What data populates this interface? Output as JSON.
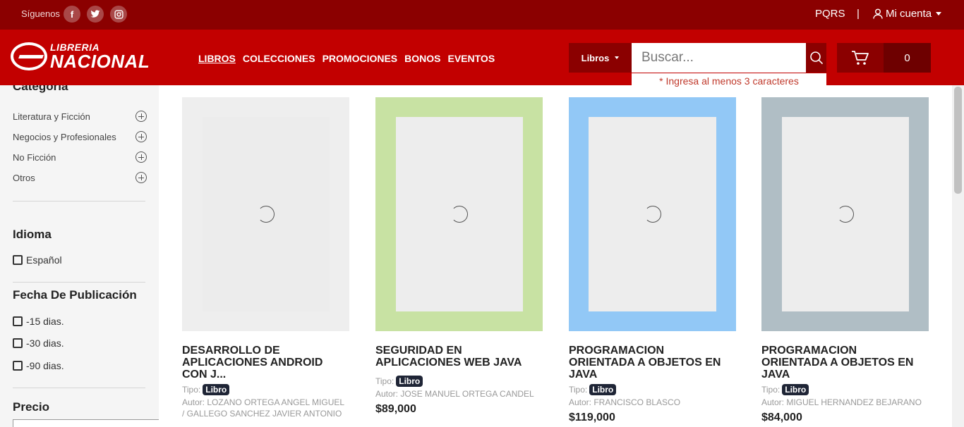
{
  "topbar": {
    "follow_label": "Síguenos",
    "social": [
      {
        "name": "facebook",
        "glyph": "f"
      },
      {
        "name": "twitter",
        "glyph": "t"
      },
      {
        "name": "instagram",
        "glyph": "◎"
      }
    ],
    "pqrs": "PQRS",
    "separator": "|",
    "account_label": "Mi cuenta"
  },
  "header": {
    "logo_line1": "LIBRERIA",
    "logo_line2": "NACIONAL",
    "nav": [
      "LIBROS",
      "COLECCIONES",
      "PROMOCIONES",
      "BONOS",
      "EVENTOS"
    ],
    "search_category": "Libros",
    "search_placeholder": "Buscar...",
    "search_hint": "* Ingresa al menos 3 caracteres",
    "cart_count": "0"
  },
  "sidebar": {
    "category_title": "Categoría",
    "categories": [
      "Literatura y Ficción",
      "Negocios y Profesionales",
      "No Ficción",
      "Otros"
    ],
    "language_title": "Idioma",
    "languages": [
      "Español"
    ],
    "date_title": "Fecha De Publicación",
    "dates": [
      "-15 dias.",
      "-30 dias.",
      "-90 dias."
    ],
    "price_title": "Precio"
  },
  "products": [
    {
      "title": "DESARROLLO DE APLICACIONES ANDROID CON J...",
      "tipo_label": "Tipo:",
      "tipo": "Libro",
      "author": "Autor: LOZANO ORTEGA ANGEL MIGUEL / GALLEGO SANCHEZ JAVIER ANTONIO",
      "price": "",
      "cover_color": "#eeeeee"
    },
    {
      "title": "SEGURIDAD EN APLICACIONES WEB JAVA",
      "tipo_label": "Tipo:",
      "tipo": "Libro",
      "author": "Autor: JOSE MANUEL ORTEGA CANDEL",
      "price": "$89,000",
      "cover_color": "#c8e2a3"
    },
    {
      "title": "PROGRAMACION ORIENTADA A OBJETOS EN JAVA",
      "tipo_label": "Tipo:",
      "tipo": "Libro",
      "author": "Autor: FRANCISCO BLASCO",
      "price": "$119,000",
      "cover_color": "#92c8f6"
    },
    {
      "title": "PROGRAMACION ORIENTADA A OBJETOS EN JAVA",
      "tipo_label": "Tipo:",
      "tipo": "Libro",
      "author": "Autor: MIGUEL HERNANDEZ BEJARANO",
      "price": "$84,000",
      "cover_color": "#b0bec5"
    }
  ]
}
